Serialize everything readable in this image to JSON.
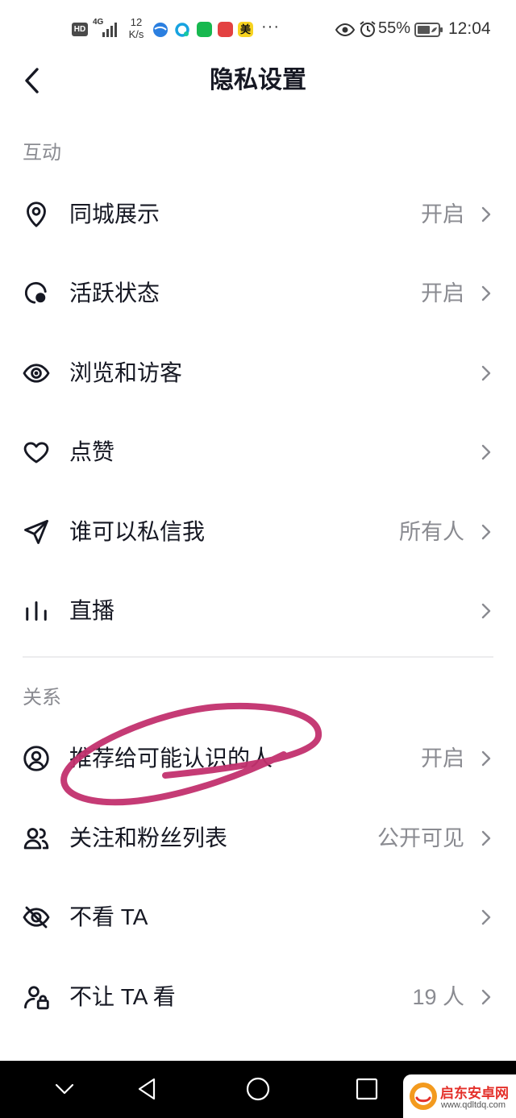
{
  "status_bar": {
    "hd": "HD",
    "network": "4G",
    "speed_value": "12",
    "speed_unit": "K/s",
    "app_icon_text": "美",
    "more": "···",
    "battery": "55%",
    "time": "12:04"
  },
  "header": {
    "title": "隐私设置",
    "back_icon": "chevron-left-icon"
  },
  "interaction": {
    "section_label": "互动",
    "items": [
      {
        "icon": "location-pin-icon",
        "label": "同城展示",
        "value": "开启"
      },
      {
        "icon": "active-status-icon",
        "label": "活跃状态",
        "value": "开启"
      },
      {
        "icon": "eye-icon",
        "label": "浏览和访客"
      },
      {
        "icon": "heart-icon",
        "label": "点赞"
      },
      {
        "icon": "send-icon",
        "label": "谁可以私信我",
        "value": "所有人"
      },
      {
        "icon": "live-bars-icon",
        "label": "直播"
      }
    ]
  },
  "relations": {
    "section_label": "关系",
    "items": [
      {
        "icon": "user-circle-icon",
        "label": "推荐给可能认识的人",
        "value": "开启"
      },
      {
        "icon": "users-icon",
        "label": "关注和粉丝列表",
        "value": "公开可见"
      },
      {
        "icon": "eye-off-icon",
        "label": "不看 TA"
      },
      {
        "icon": "user-lock-icon",
        "label": "不让 TA 看",
        "value": "19 人"
      }
    ]
  },
  "navigation": {
    "buttons": [
      "chevron-down-icon",
      "back-triangle-icon",
      "home-circle-icon",
      "recents-square-icon"
    ]
  },
  "watermark": {
    "name": "启东安卓网",
    "url": "www.qdltdq.com"
  },
  "colors": {
    "text": "#161823",
    "secondary": "#8a8b91",
    "divider": "#ececee",
    "annotation": "#c2306e",
    "nav_bar": "#000000",
    "watermark_red": "#e4302a"
  }
}
